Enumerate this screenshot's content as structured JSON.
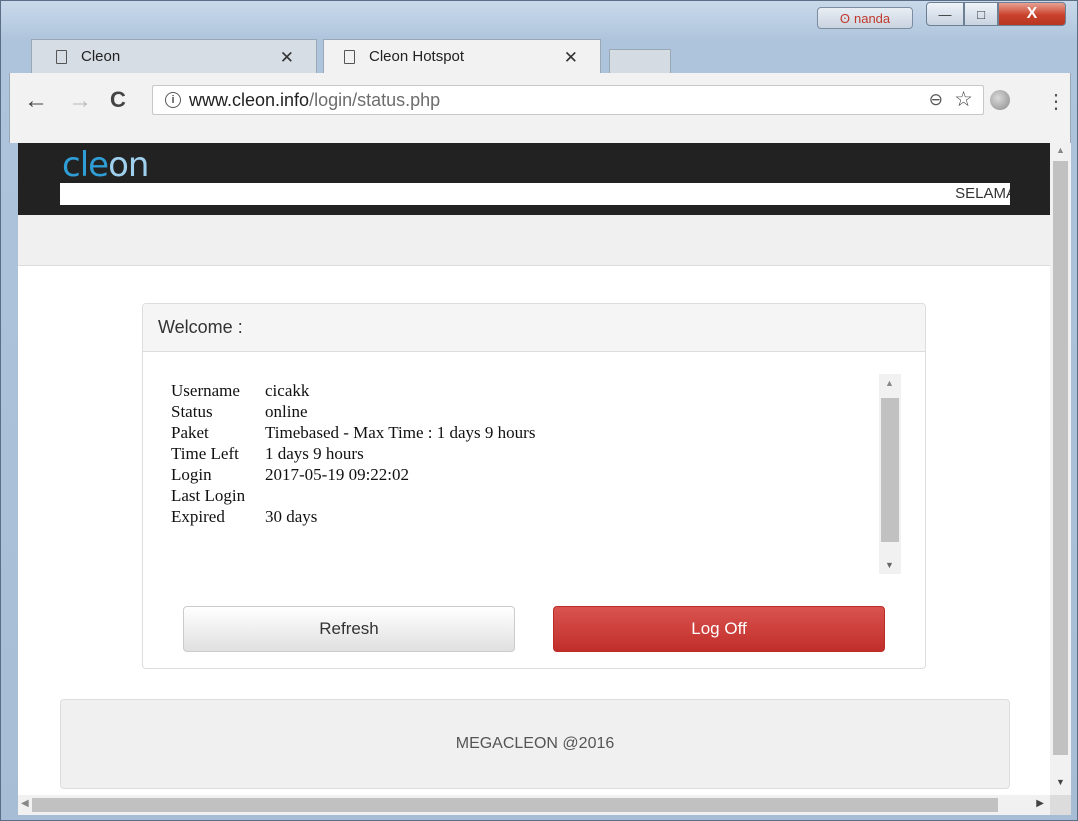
{
  "window": {
    "profile_name": "nanda",
    "minimize_glyph": "—",
    "maximize_glyph": "□",
    "close_glyph": "X"
  },
  "tabs": [
    {
      "title": "Cleon",
      "active": false
    },
    {
      "title": "Cleon Hotspot",
      "active": true
    }
  ],
  "toolbar": {
    "back": "←",
    "forward": "→",
    "reload": "C",
    "url_host": "www.cleon.info",
    "url_path": "/login/status.php",
    "zoom_icon": "⊖",
    "bookmark_icon": "☆",
    "menu_icon": "⋮"
  },
  "page": {
    "logo": {
      "text_a": "cle",
      "text_b": "on"
    },
    "marquee_text": "SELAMA",
    "panel_title": "Welcome :",
    "info": [
      {
        "label": "Username",
        "value": "cicakk"
      },
      {
        "label": "Status",
        "value": "online"
      },
      {
        "label": "Paket",
        "value": "Timebased - Max Time : 1 days 9 hours"
      },
      {
        "label": "Time Left",
        "value": "1 days 9 hours"
      },
      {
        "label": "Login",
        "value": "2017-05-19 09:22:02"
      },
      {
        "label": "Last Login",
        "value": ""
      },
      {
        "label": "Expired",
        "value": "30 days"
      }
    ],
    "buttons": {
      "refresh": "Refresh",
      "logoff": "Log Off"
    },
    "footer": "MEGACLEON @2016"
  },
  "colors": {
    "header_bg": "#222222",
    "logo_blue": "#2f9ed6",
    "logoff_red": "#c9302c"
  }
}
